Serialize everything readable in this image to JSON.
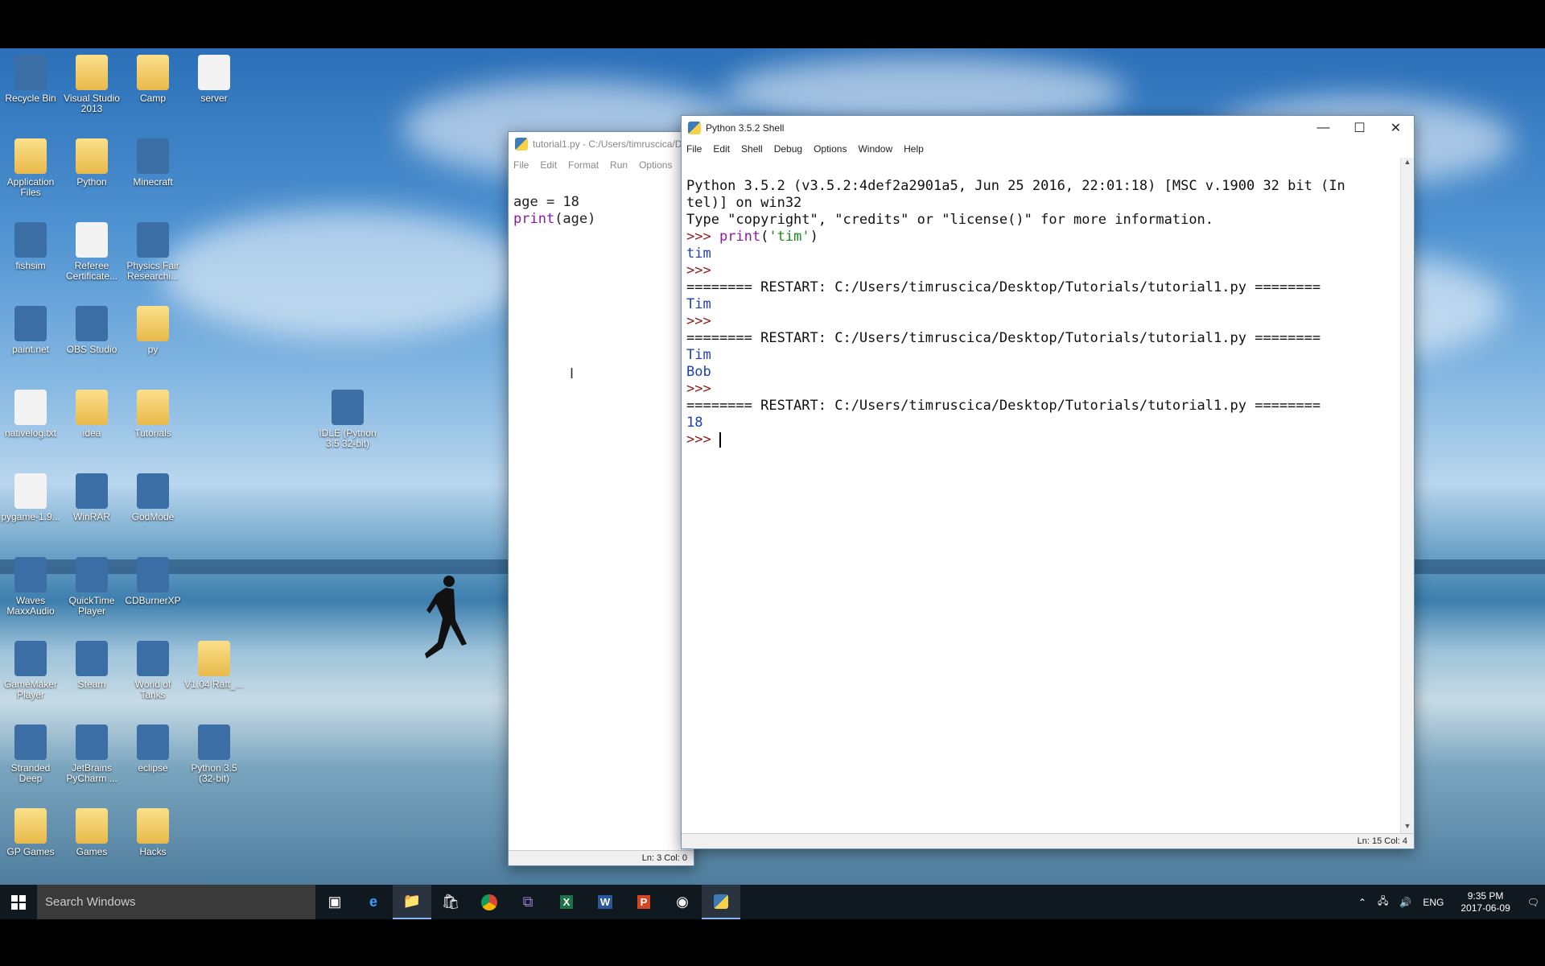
{
  "desktop_icons": [
    {
      "label": "Recycle Bin",
      "icon": "recycle-bin-icon"
    },
    {
      "label": "Visual Studio 2013",
      "icon": "folder-icon"
    },
    {
      "label": "Camp",
      "icon": "folder-icon"
    },
    {
      "label": "server",
      "icon": "file-icon"
    },
    {
      "label": "Application Files",
      "icon": "folder-icon"
    },
    {
      "label": "Python",
      "icon": "folder-icon"
    },
    {
      "label": "Minecraft",
      "icon": "minecraft-icon"
    },
    {
      "label": "fishsim",
      "icon": "excel-icon"
    },
    {
      "label": "Referee Certificate...",
      "icon": "document-icon"
    },
    {
      "label": "Physics Fair Researchi...",
      "icon": "word-icon"
    },
    {
      "label": "paint.net",
      "icon": "paintnet-icon"
    },
    {
      "label": "OBS Studio",
      "icon": "obs-icon"
    },
    {
      "label": "py",
      "icon": "folder-icon"
    },
    {
      "label": "nativelog.txt",
      "icon": "text-file-icon"
    },
    {
      "label": "idea",
      "icon": "folder-icon"
    },
    {
      "label": "Tutorials",
      "icon": "folder-icon"
    },
    {
      "label": "IDLE (Python 3.5 32-bit)",
      "icon": "python-icon"
    },
    {
      "label": "pygame-1.9...",
      "icon": "text-file-icon"
    },
    {
      "label": "WinRAR",
      "icon": "winrar-icon"
    },
    {
      "label": "GodMode",
      "icon": "control-panel-icon"
    },
    {
      "label": "Waves MaxxAudio",
      "icon": "waves-icon"
    },
    {
      "label": "QuickTime Player",
      "icon": "quicktime-icon"
    },
    {
      "label": "CDBurnerXP",
      "icon": "cd-icon"
    },
    {
      "label": "GameMaker Player",
      "icon": "gamemaker-icon"
    },
    {
      "label": "Steam",
      "icon": "steam-icon"
    },
    {
      "label": "World of Tanks",
      "icon": "tank-icon"
    },
    {
      "label": "V1.04 Raft_...",
      "icon": "folder-icon"
    },
    {
      "label": "Stranded Deep",
      "icon": "stranded-icon"
    },
    {
      "label": "JetBrains PyCharm ...",
      "icon": "pycharm-icon"
    },
    {
      "label": "eclipse",
      "icon": "eclipse-icon"
    },
    {
      "label": "Python 3.5 (32-bit)",
      "icon": "python-icon"
    },
    {
      "label": "GP Games",
      "icon": "folder-icon"
    },
    {
      "label": "Games",
      "icon": "folder-icon"
    },
    {
      "label": "Hacks",
      "icon": "folder-icon"
    }
  ],
  "editor": {
    "title": "tutorial1.py - C:/Users/timruscica/D",
    "menu": [
      "File",
      "Edit",
      "Format",
      "Run",
      "Options"
    ],
    "lines": [
      {
        "plain": "age = 18",
        "builtin": "",
        "rest": ""
      },
      {
        "plain": "",
        "builtin": "print",
        "rest": "(age)"
      }
    ],
    "status": "Ln: 3   Col: 0"
  },
  "shell": {
    "title": "Python 3.5.2 Shell",
    "menu": [
      "File",
      "Edit",
      "Shell",
      "Debug",
      "Options",
      "Window",
      "Help"
    ],
    "banner1": "Python 3.5.2 (v3.5.2:4def2a2901a5, Jun 25 2016, 22:01:18) [MSC v.1900 32 bit (In",
    "banner2": "tel)] on win32",
    "banner3": "Type \"copyright\", \"credits\" or \"license()\" for more information.",
    "prompt": ">>> ",
    "cmd1_func": "print",
    "cmd1_paren_open": "(",
    "cmd1_str": "'tim'",
    "cmd1_paren_close": ")",
    "out1": "tim",
    "restart": "======== RESTART: C:/Users/timruscica/Desktop/Tutorials/tutorial1.py ========",
    "out2": "Tim",
    "out3a": "Tim",
    "out3b": "Bob",
    "out4": "18",
    "status": "Ln: 15   Col: 4"
  },
  "taskbar": {
    "search_placeholder": "Search Windows",
    "time": "9:35 PM",
    "date": "2017-06-09",
    "lang": "ENG"
  },
  "colors": {
    "prompt": "#8b1a1a",
    "output": "#1f3fb0",
    "string": "#1a8a1a",
    "builtin": "#8a1aa0"
  }
}
